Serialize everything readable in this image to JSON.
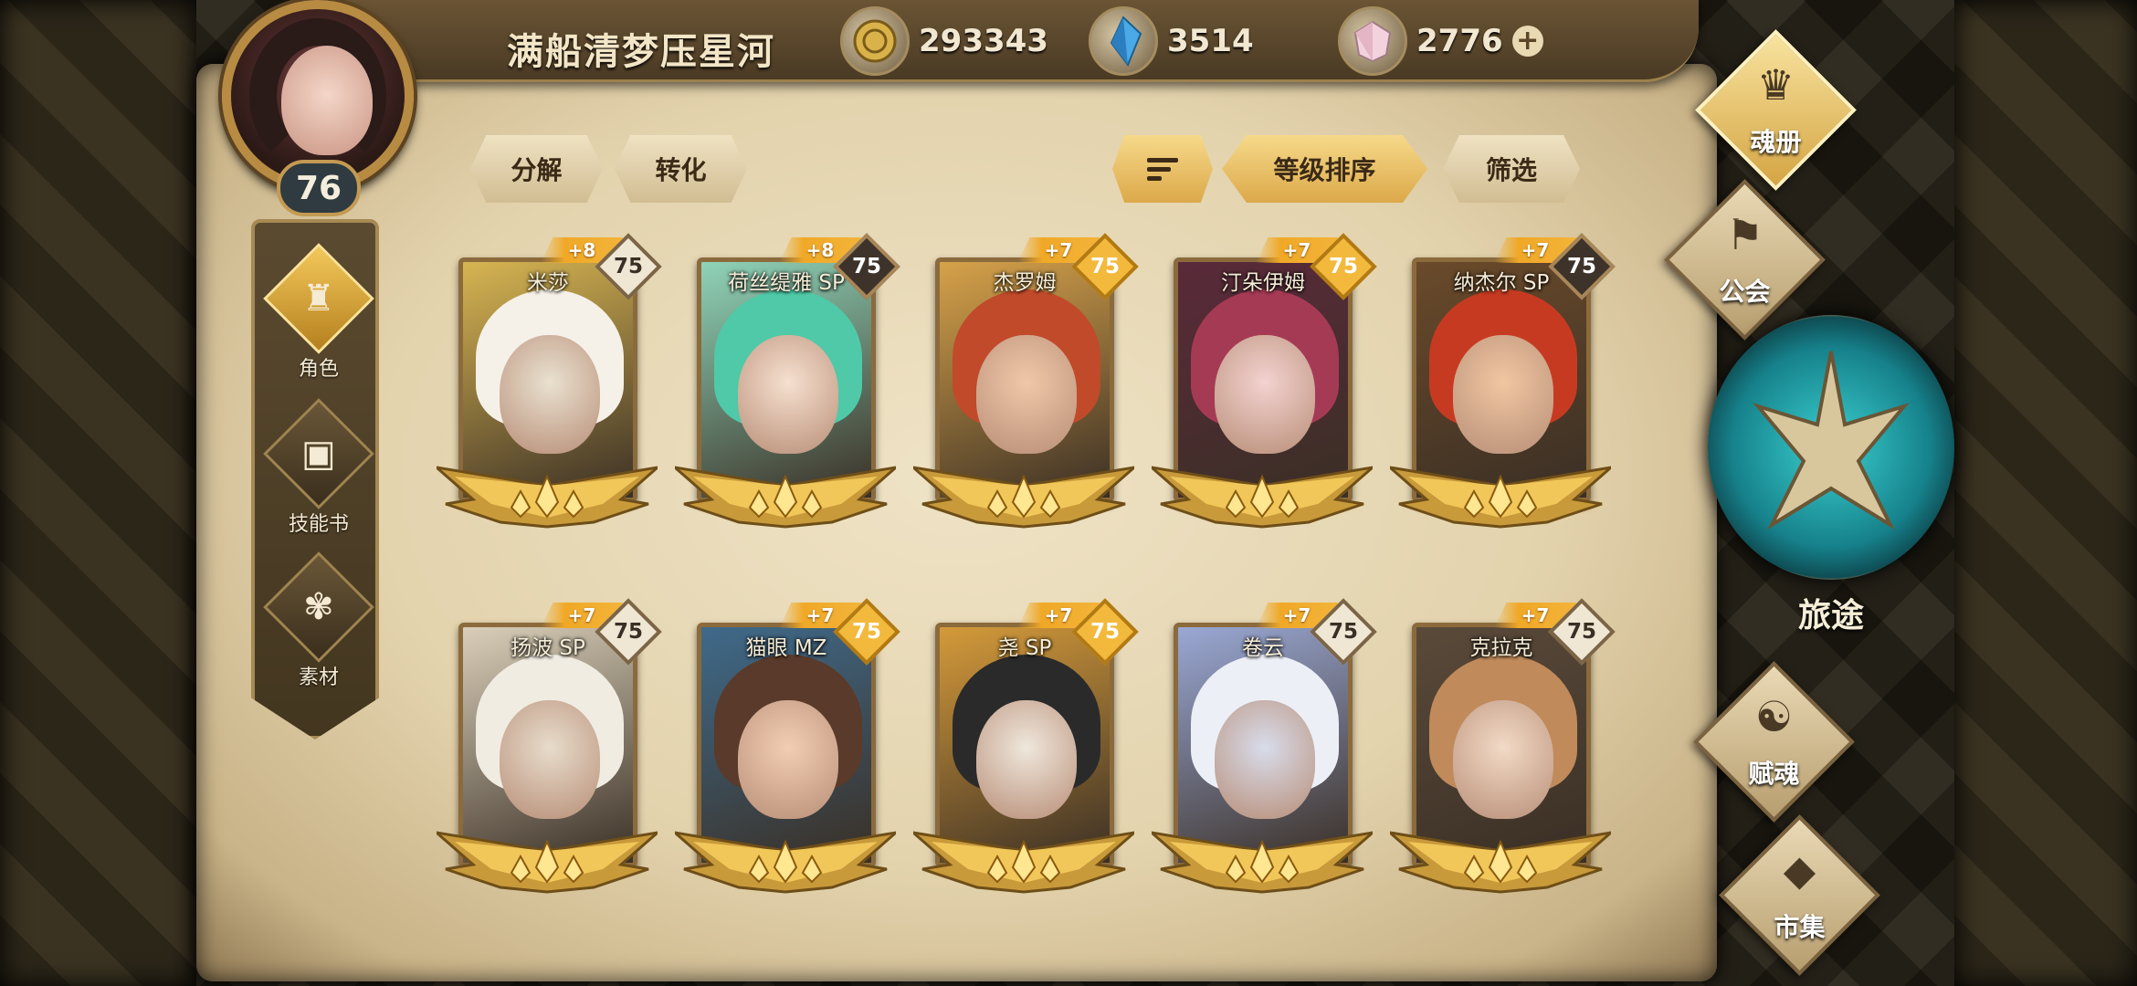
{
  "player": {
    "name": "满船清梦压星河",
    "level": "76"
  },
  "resources": [
    {
      "name": "gold-coin",
      "value": "293343",
      "icon": "coin-icon"
    },
    {
      "name": "crystal",
      "value": "3514",
      "icon": "crystal-icon"
    },
    {
      "name": "gem",
      "value": "2776",
      "icon": "gem-icon",
      "has_plus": true
    }
  ],
  "left_nav": [
    {
      "label": "角色",
      "icon": "helmet-icon",
      "active": true
    },
    {
      "label": "技能书",
      "icon": "book-icon",
      "active": false
    },
    {
      "label": "素材",
      "icon": "material-icon",
      "active": false
    }
  ],
  "actions": {
    "decompose": "分解",
    "convert": "转化",
    "sort_label": "等级排序",
    "filter": "筛选"
  },
  "cards": [
    {
      "name": "米莎",
      "plus": "+8",
      "level": "75",
      "badge": "light"
    },
    {
      "name": "荷丝缇雅 SP",
      "plus": "+8",
      "level": "75",
      "badge": "dark"
    },
    {
      "name": "杰罗姆",
      "plus": "+7",
      "level": "75",
      "badge": "gold"
    },
    {
      "name": "汀朵伊姆",
      "plus": "+7",
      "level": "75",
      "badge": "gold"
    },
    {
      "name": "纳杰尔 SP",
      "plus": "+7",
      "level": "75",
      "badge": "dark"
    },
    {
      "name": "扬波 SP",
      "plus": "+7",
      "level": "75",
      "badge": "light"
    },
    {
      "name": "猫眼 MZ",
      "plus": "+7",
      "level": "75",
      "badge": "gold"
    },
    {
      "name": "尧 SP",
      "plus": "+7",
      "level": "75",
      "badge": "gold"
    },
    {
      "name": "卷云",
      "plus": "+7",
      "level": "75",
      "badge": "light"
    },
    {
      "name": "克拉克",
      "plus": "+7",
      "level": "75",
      "badge": "light"
    }
  ],
  "right_menu": [
    {
      "label": "魂册",
      "icon": "soul-book-icon",
      "active": true
    },
    {
      "label": "公会",
      "icon": "guild-icon",
      "active": false
    },
    {
      "label": "赋魂",
      "icon": "soul-flame-icon",
      "active": false
    },
    {
      "label": "市集",
      "icon": "market-icon",
      "active": false
    }
  ],
  "journey": {
    "label": "旅途",
    "icon": "journey-emblem-icon"
  }
}
